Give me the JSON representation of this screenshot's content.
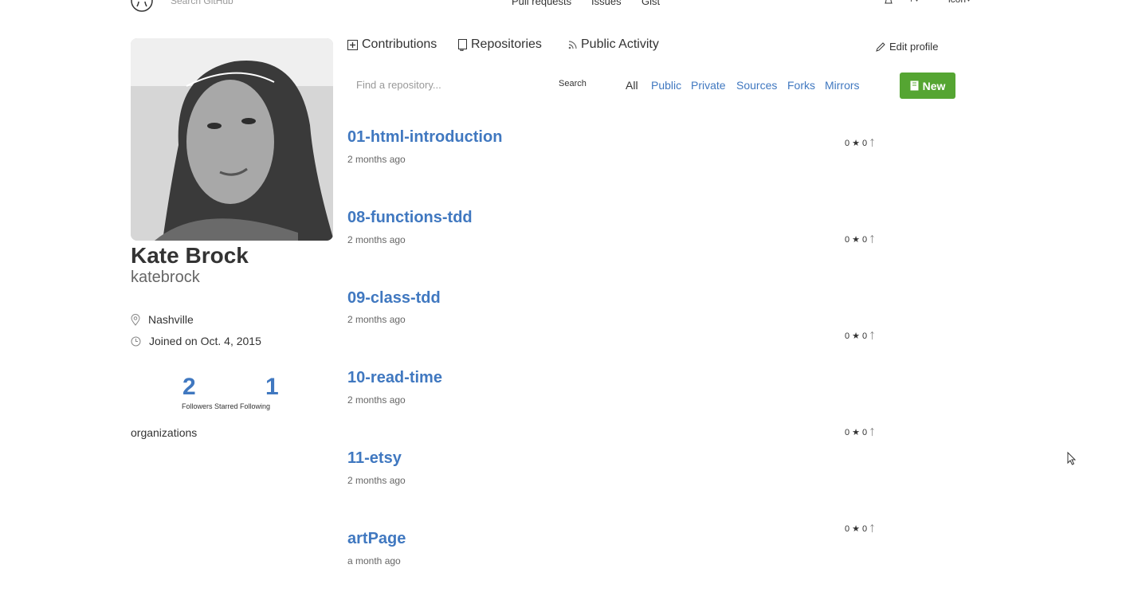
{
  "header": {
    "search_placeholder": "Search GitHub",
    "nav": [
      "Pull requests",
      "Issues",
      "Gist"
    ],
    "icon_label": "icon"
  },
  "profile": {
    "full_name": "Kate Brock",
    "username": "katebrock",
    "location": "Nashville",
    "joined": "Joined on Oct. 4, 2015",
    "stats": {
      "followers": "2",
      "following": "1",
      "labels": "Followers Starred Following"
    },
    "organizations_label": "organizations"
  },
  "tabs": {
    "contributions": "Contributions",
    "repositories": "Repositories",
    "public_activity": "Public Activity",
    "edit_profile": "Edit profile"
  },
  "filters": {
    "search_placeholder": "Find a repository...",
    "search_button": "Search",
    "items": [
      "All",
      "Public",
      "Private",
      "Sources",
      "Forks",
      "Mirrors"
    ],
    "active": "All",
    "new_button": "New"
  },
  "repos": [
    {
      "name": "01-html-introduction",
      "updated": "2 months ago",
      "stars": "0",
      "forks": "0"
    },
    {
      "name": "08-functions-tdd",
      "updated": "2 months ago",
      "stars": "0",
      "forks": "0"
    },
    {
      "name": "09-class-tdd",
      "updated": "2 months ago",
      "stars": "0",
      "forks": "0"
    },
    {
      "name": "10-read-time",
      "updated": "2 months ago",
      "stars": "0",
      "forks": "0"
    },
    {
      "name": "11-etsy",
      "updated": "2 months ago",
      "stars": "0",
      "forks": "0"
    },
    {
      "name": "artPage",
      "updated": "a month ago",
      "stars": "0",
      "forks": "0"
    }
  ],
  "colors": {
    "link": "#4078c0",
    "new_button": "#55a532",
    "text": "#333333",
    "muted": "#666666"
  },
  "icons": [
    "octocat-logo-icon",
    "location-pin-icon",
    "clock-icon",
    "plus-square-icon",
    "repo-icon",
    "rss-icon",
    "pencil-icon",
    "book-icon",
    "star-icon",
    "fork-icon",
    "cursor-icon"
  ]
}
